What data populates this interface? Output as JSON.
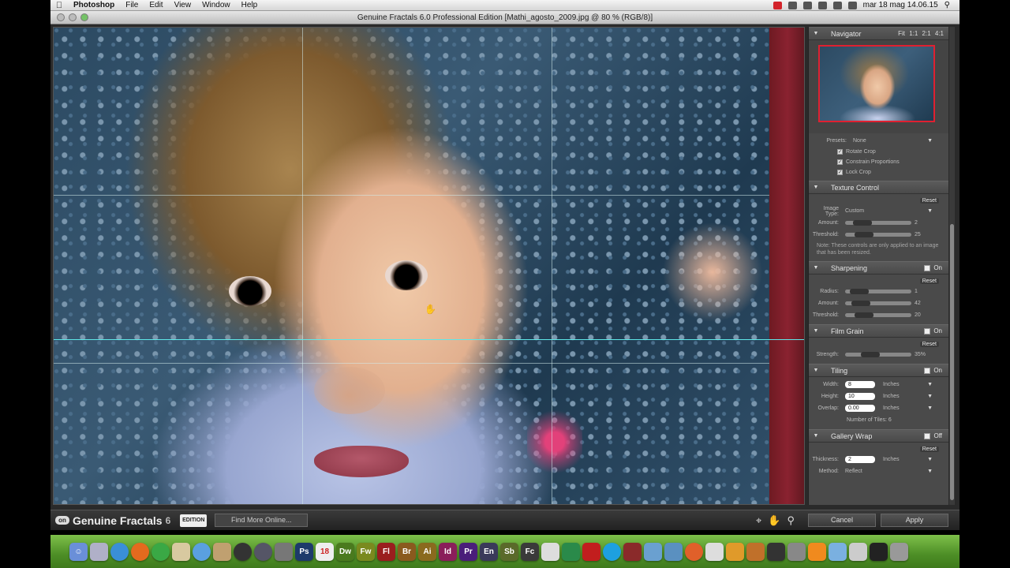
{
  "menubar": {
    "items": [
      "Photoshop",
      "File",
      "Edit",
      "View",
      "Window",
      "Help"
    ],
    "clock": "mar 18 mag  14.06.15"
  },
  "window": {
    "title": "Genuine Fractals 6.0 Professional Edition [Mathi_agosto_2009.jpg @ 80 % (RGB/8)]"
  },
  "panel": {
    "navigator": {
      "label": "Navigator",
      "zoom_options": "Fit 1:1 2:1 4:1"
    },
    "crop": {
      "presets_label": "Presets:",
      "presets_value": "None",
      "rotate_crop": "Rotate Crop",
      "constrain": "Constrain Proportions",
      "lock_crop": "Lock Crop"
    },
    "texture": {
      "label": "Texture Control",
      "reset": "Reset",
      "image_type_label": "Image Type:",
      "image_type_value": "Custom",
      "amount_label": "Amount:",
      "amount_value": "2",
      "threshold_label": "Threshold:",
      "threshold_value": "25",
      "note": "Note: These controls are only applied to an image that has been resized."
    },
    "sharpening": {
      "label": "Sharpening",
      "toggle": "On",
      "reset": "Reset",
      "radius_label": "Radius:",
      "radius_value": "1",
      "amount_label": "Amount:",
      "amount_value": "42",
      "threshold_label": "Threshold:",
      "threshold_value": "20"
    },
    "film_grain": {
      "label": "Film Grain",
      "toggle": "On",
      "reset": "Reset",
      "strength_label": "Strength:",
      "strength_value": "35%"
    },
    "tiling": {
      "label": "Tiling",
      "toggle": "On",
      "width_label": "Width:",
      "width_value": "8",
      "height_label": "Height:",
      "height_value": "10",
      "overlap_label": "Overlap:",
      "overlap_value": "0.00",
      "unit": "Inches",
      "tiles_count": "Number of Tiles: 6"
    },
    "gallery_wrap": {
      "label": "Gallery Wrap",
      "toggle": "Off",
      "reset": "Reset",
      "thickness_label": "Thickness:",
      "thickness_value": "2",
      "unit": "Inches",
      "method_label": "Method:",
      "method_value": "Reflect"
    }
  },
  "bottom": {
    "brand": "Genuine Fractals",
    "version": "6",
    "edition": "EDITION",
    "find_more": "Find More Online...",
    "cancel": "Cancel",
    "apply": "Apply"
  },
  "dock": {
    "items": [
      "Ps",
      "18",
      "Dw",
      "Fw",
      "Fl",
      "Br",
      "Ai",
      "Id",
      "Pr",
      "En",
      "Sb",
      "Fc"
    ]
  },
  "colors": {
    "accent_cyan": "#5fe7e8",
    "crop_red": "#e02030",
    "panel_bg": "#4a4a4a"
  }
}
